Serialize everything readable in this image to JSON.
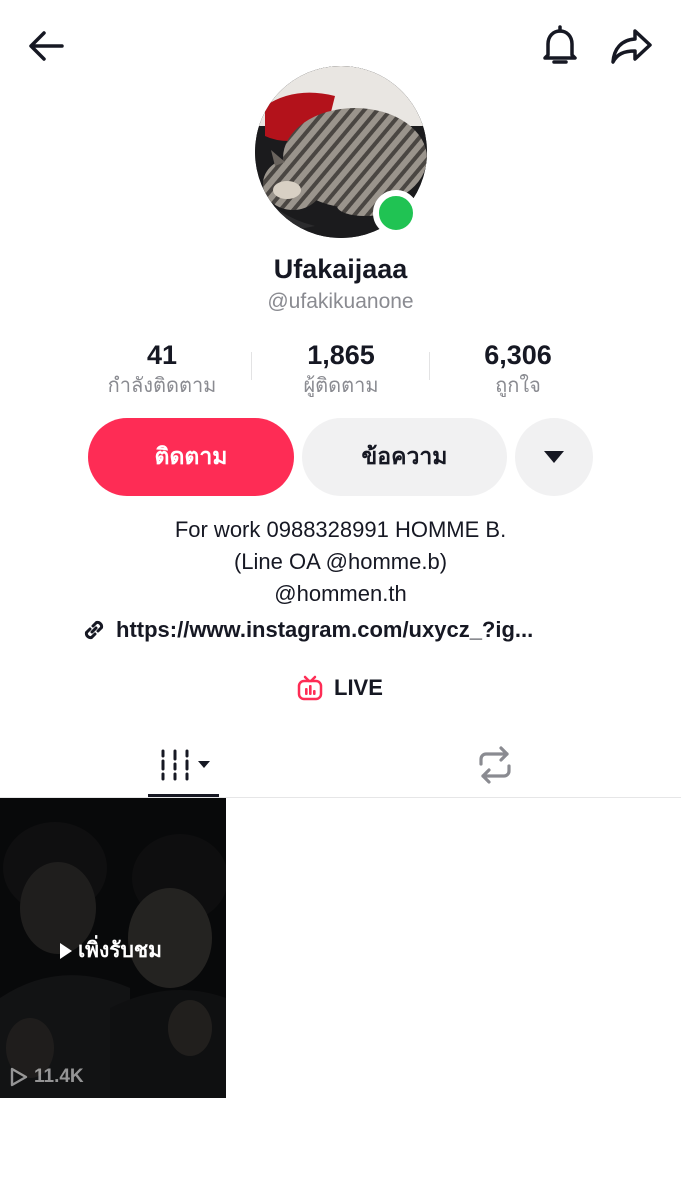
{
  "header": {
    "back_icon": "arrow-left-icon",
    "notification_icon": "bell-icon",
    "share_icon": "share-arrow-icon"
  },
  "profile": {
    "avatar_icon": "cat-avatar-photo",
    "online_status_color": "#20c353",
    "nickname": "Ufakaijaaa",
    "username": "@ufakikuanone"
  },
  "stats": [
    {
      "value": "41",
      "label": "กำลังติดตาม"
    },
    {
      "value": "1,865",
      "label": "ผู้ติดตาม"
    },
    {
      "value": "6,306",
      "label": "ถูกใจ"
    }
  ],
  "actions": {
    "follow_label": "ติดตาม",
    "message_label": "ข้อความ",
    "more_icon": "caret-down-icon",
    "accent_color": "#fe2c55"
  },
  "bio": {
    "lines": [
      "For work 0988328991 HOMME B.",
      "(Line OA @homme.b)",
      "@hommen.th"
    ],
    "link_icon": "link-icon",
    "link": "https://www.instagram.com/uxycz_?ig..."
  },
  "live": {
    "icon": "tv-live-icon",
    "label": "LIVE"
  },
  "tabs": {
    "videos_icon": "grid-bars-icon",
    "reposts_icon": "repost-icon"
  },
  "videos": [
    {
      "badge": "เพิ่งรับชม",
      "views": "11.4K"
    }
  ]
}
